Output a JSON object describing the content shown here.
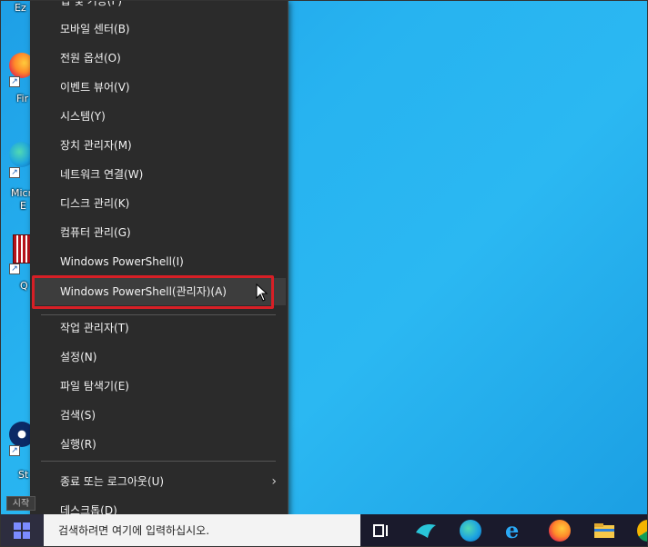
{
  "desktop": {
    "icons": [
      {
        "caption": "Ez"
      },
      {
        "caption": "Fir"
      },
      {
        "caption": "Micr"
      },
      {
        "caption": "E"
      },
      {
        "caption": "Q"
      },
      {
        "caption": "St"
      }
    ]
  },
  "menu": {
    "items": [
      {
        "label": "앱 및 기능(F)"
      },
      {
        "label": "모바일 센터(B)"
      },
      {
        "label": "전원 옵션(O)"
      },
      {
        "label": "이벤트 뷰어(V)"
      },
      {
        "label": "시스템(Y)"
      },
      {
        "label": "장치 관리자(M)"
      },
      {
        "label": "네트워크 연결(W)"
      },
      {
        "label": "디스크 관리(K)"
      },
      {
        "label": "컴퓨터 관리(G)"
      },
      {
        "label": "Windows PowerShell(I)"
      },
      {
        "label": "Windows PowerShell(관리자)(A)"
      },
      {
        "label": "작업 관리자(T)"
      },
      {
        "label": "설정(N)"
      },
      {
        "label": "파일 탐색기(E)"
      },
      {
        "label": "검색(S)"
      },
      {
        "label": "실행(R)"
      },
      {
        "label": "종료 또는 로그아웃(U)"
      },
      {
        "label": "데스크톱(D)"
      }
    ],
    "submenu_arrow": "›",
    "highlight_color": "#d71f26"
  },
  "taskbar": {
    "start_tooltip": "시작",
    "search_text": "검색하려면 여기에 입력하십시오."
  }
}
